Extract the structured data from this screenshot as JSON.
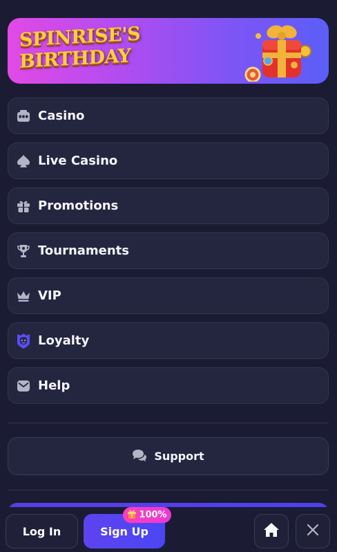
{
  "banner": {
    "title_line1": "SPINRISE'S",
    "title_line2": "BIRTHDAY"
  },
  "menu": {
    "items": [
      {
        "label": "Casino",
        "icon": "slot-machine-icon"
      },
      {
        "label": "Live Casino",
        "icon": "spade-icon"
      },
      {
        "label": "Promotions",
        "icon": "gift-icon"
      },
      {
        "label": "Tournaments",
        "icon": "trophy-icon"
      },
      {
        "label": "VIP",
        "icon": "crown-icon"
      },
      {
        "label": "Loyalty",
        "icon": "loyalty-shield-icon"
      },
      {
        "label": "Help",
        "icon": "message-icon"
      }
    ]
  },
  "support": {
    "label": "Support",
    "icon": "chat-bubbles-icon"
  },
  "bottom_bar": {
    "login_label": "Log In",
    "signup_label": "Sign Up",
    "bonus_badge": "100%",
    "home_icon": "home-icon",
    "close_icon": "close-icon"
  },
  "colors": {
    "background": "#1b1c33",
    "card": "#24253e",
    "accent": "#4a46f5",
    "badge": "#ff3fb6",
    "loyalty_icon": "#5a4cf5"
  }
}
